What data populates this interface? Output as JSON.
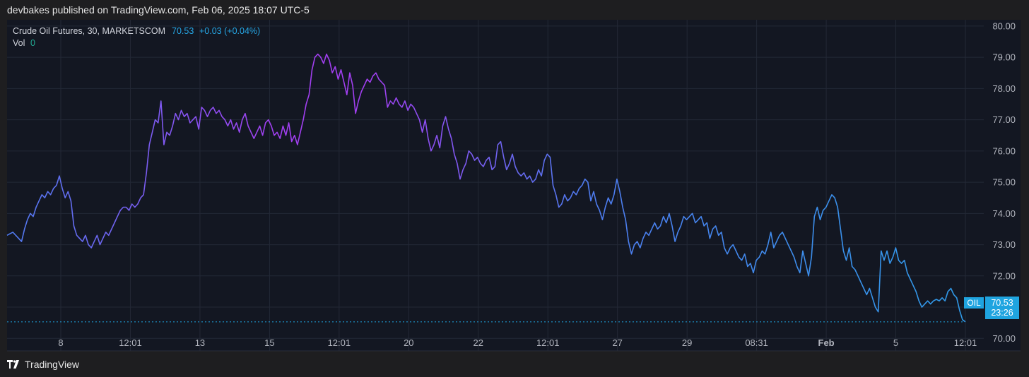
{
  "header": {
    "published": "devbakes published on TradingView.com, Feb 06, 2025 18:07 UTC-5"
  },
  "footer": {
    "brand": "TradingView"
  },
  "legend": {
    "symbol": "Crude Oil Futures, 30, MARKETSCOM",
    "price": "70.53",
    "change": "+0.03 (+0.04%)",
    "vol_label": "Vol",
    "vol_value": "0"
  },
  "price_label": {
    "ticker": "OIL",
    "price": "70.53",
    "countdown": "23:26"
  },
  "colors": {
    "background": "#131722",
    "grid": "#232836",
    "line_start": "#4f7bf0",
    "line_mid": "#a13ff0",
    "line_end": "#2f9ae8",
    "price_tag": "#1fa4e0",
    "change": "#26a7e6",
    "vol": "#22ab94"
  },
  "chart_data": {
    "type": "line",
    "title": "Crude Oil Futures, 30, MARKETSCOM",
    "ylim": [
      69.6,
      80.2
    ],
    "y_ticks": [
      "80.00",
      "79.00",
      "78.00",
      "77.00",
      "76.00",
      "75.00",
      "74.00",
      "73.00",
      "72.00",
      "71.00",
      "70.00"
    ],
    "x_ticks": [
      "8",
      "12:01",
      "13",
      "15",
      "12:01",
      "20",
      "22",
      "12:01",
      "27",
      "29",
      "08:31",
      "Feb",
      "5",
      "12:01"
    ],
    "grid": true,
    "last_price": 70.53,
    "series": [
      {
        "values": [
          73.3,
          73.35,
          73.4,
          73.3,
          73.2,
          73.1,
          73.5,
          73.8,
          74.0,
          73.9,
          74.2,
          74.4,
          74.6,
          74.5,
          74.7,
          74.6,
          74.8,
          74.9,
          75.2,
          74.8,
          74.5,
          74.7,
          74.4,
          73.6,
          73.3,
          73.2,
          73.1,
          73.3,
          73.0,
          72.9,
          73.1,
          73.3,
          73.0,
          73.2,
          73.4,
          73.3,
          73.5,
          73.7,
          73.9,
          74.1,
          74.2,
          74.2,
          74.1,
          74.3,
          74.2,
          74.3,
          74.5,
          74.6,
          75.3,
          76.2,
          76.6,
          77.0,
          76.9,
          77.6,
          76.2,
          76.6,
          76.5,
          76.8,
          77.2,
          77.0,
          77.3,
          77.1,
          77.2,
          76.9,
          77.0,
          77.1,
          76.7,
          77.4,
          77.3,
          77.1,
          77.3,
          77.4,
          77.2,
          77.3,
          77.1,
          77.0,
          76.8,
          77.0,
          76.7,
          76.9,
          76.6,
          77.0,
          77.2,
          76.8,
          76.6,
          76.4,
          76.6,
          76.8,
          76.5,
          76.9,
          77.0,
          76.8,
          76.5,
          76.6,
          76.4,
          76.8,
          76.5,
          76.9,
          76.3,
          76.5,
          76.2,
          76.6,
          77.0,
          77.5,
          77.8,
          78.6,
          79.0,
          79.1,
          79.0,
          78.8,
          79.1,
          78.9,
          78.5,
          78.7,
          78.3,
          78.6,
          78.2,
          77.8,
          78.5,
          78.1,
          77.2,
          77.6,
          77.9,
          78.1,
          78.3,
          78.2,
          78.4,
          78.5,
          78.3,
          78.2,
          78.1,
          77.4,
          77.6,
          77.5,
          77.7,
          77.5,
          77.4,
          77.6,
          77.3,
          77.5,
          77.4,
          77.2,
          77.0,
          76.6,
          77.0,
          76.4,
          76.0,
          76.2,
          76.5,
          76.1,
          76.8,
          77.1,
          76.7,
          76.4,
          75.9,
          75.6,
          75.1,
          75.4,
          75.6,
          76.0,
          75.9,
          75.7,
          75.8,
          75.6,
          75.5,
          75.7,
          75.8,
          75.4,
          75.5,
          76.2,
          76.3,
          75.8,
          75.4,
          75.6,
          75.9,
          75.5,
          75.3,
          75.2,
          75.3,
          75.1,
          75.2,
          75.0,
          75.1,
          75.4,
          75.2,
          75.7,
          75.9,
          75.8,
          74.9,
          74.6,
          74.2,
          74.3,
          74.6,
          74.4,
          74.5,
          74.7,
          74.6,
          74.8,
          74.9,
          75.1,
          75.0,
          74.4,
          74.7,
          74.3,
          74.1,
          73.8,
          74.2,
          74.5,
          74.3,
          74.6,
          75.1,
          74.7,
          74.2,
          73.8,
          73.1,
          72.7,
          73.0,
          73.1,
          72.9,
          73.2,
          73.4,
          73.3,
          73.5,
          73.7,
          73.5,
          73.6,
          73.9,
          73.7,
          74.0,
          73.6,
          73.1,
          73.4,
          73.6,
          73.9,
          73.8,
          73.9,
          74.0,
          73.7,
          73.8,
          73.9,
          73.6,
          73.7,
          73.2,
          73.5,
          73.6,
          73.3,
          73.4,
          72.9,
          72.7,
          72.9,
          73.0,
          72.8,
          72.6,
          72.5,
          72.7,
          72.3,
          72.4,
          72.1,
          72.5,
          72.6,
          72.8,
          72.7,
          73.0,
          73.4,
          72.9,
          73.1,
          73.3,
          73.4,
          73.2,
          73.0,
          72.8,
          72.6,
          72.3,
          72.1,
          72.8,
          72.4,
          72.0,
          72.6,
          73.9,
          74.2,
          73.8,
          74.1,
          74.2,
          74.4,
          74.6,
          74.5,
          74.2,
          73.5,
          72.8,
          72.5,
          72.9,
          72.3,
          72.2,
          72.0,
          71.8,
          71.6,
          71.4,
          71.6,
          71.3,
          71.0,
          70.85,
          72.8,
          72.5,
          72.8,
          72.4,
          72.6,
          72.9,
          72.5,
          72.4,
          72.5,
          72.1,
          71.9,
          71.7,
          71.5,
          71.2,
          71.0,
          71.1,
          71.2,
          71.1,
          71.2,
          71.25,
          71.2,
          71.3,
          71.2,
          71.5,
          71.6,
          71.4,
          71.3,
          70.9,
          70.6,
          70.53
        ]
      }
    ]
  }
}
